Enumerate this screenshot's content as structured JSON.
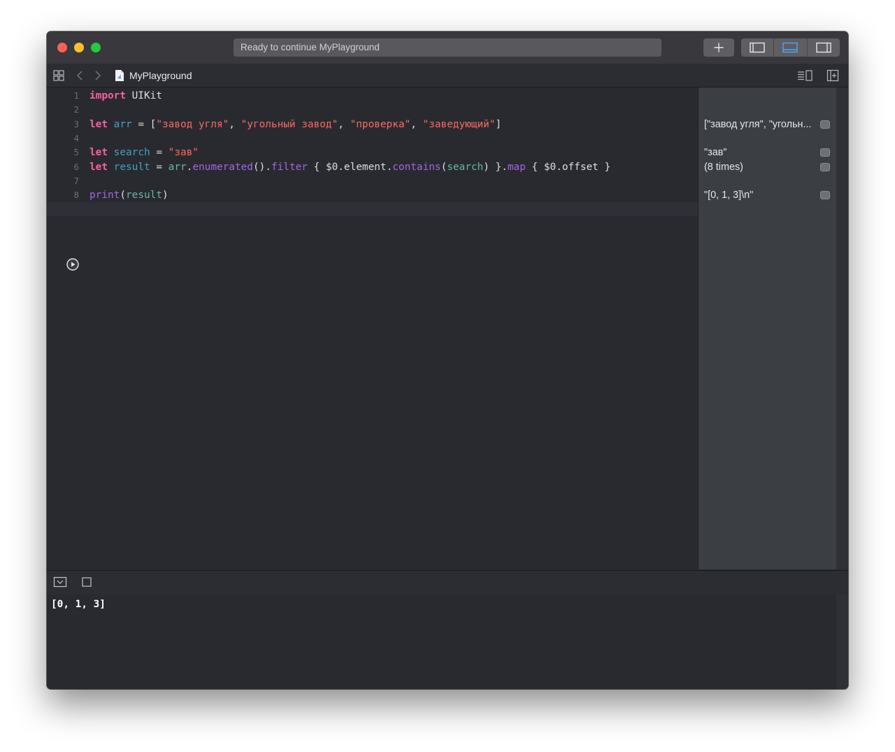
{
  "window": {
    "status": "Ready to continue MyPlayground"
  },
  "toolbar": {
    "add_icon": "plus-icon",
    "view_buttons": [
      "hide-navigator-icon",
      "hide-debug-area-icon",
      "hide-inspector-icon"
    ]
  },
  "navbar": {
    "breadcrumb": "MyPlayground",
    "file_icon": "swift-file-icon"
  },
  "editor": {
    "line_numbers": [
      "1",
      "2",
      "3",
      "4",
      "5",
      "6",
      "7",
      "8"
    ],
    "lines": [
      [
        {
          "t": "import",
          "c": "kw"
        },
        {
          "t": " UIKit",
          "c": "plain"
        }
      ],
      [],
      [
        {
          "t": "let",
          "c": "kw"
        },
        {
          "t": " ",
          "c": "plain"
        },
        {
          "t": "arr",
          "c": "decl"
        },
        {
          "t": " = [",
          "c": "plain"
        },
        {
          "t": "\"завод угля\"",
          "c": "str"
        },
        {
          "t": ", ",
          "c": "plain"
        },
        {
          "t": "\"угольный завод\"",
          "c": "str"
        },
        {
          "t": ", ",
          "c": "plain"
        },
        {
          "t": "\"проверка\"",
          "c": "str"
        },
        {
          "t": ", ",
          "c": "plain"
        },
        {
          "t": "\"заведующий\"",
          "c": "str"
        },
        {
          "t": "]",
          "c": "plain"
        }
      ],
      [],
      [
        {
          "t": "let",
          "c": "kw"
        },
        {
          "t": " ",
          "c": "plain"
        },
        {
          "t": "search",
          "c": "decl"
        },
        {
          "t": " = ",
          "c": "plain"
        },
        {
          "t": "\"зав\"",
          "c": "str"
        }
      ],
      [
        {
          "t": "let",
          "c": "kw"
        },
        {
          "t": " ",
          "c": "plain"
        },
        {
          "t": "result",
          "c": "decl"
        },
        {
          "t": " = ",
          "c": "plain"
        },
        {
          "t": "arr",
          "c": "proj"
        },
        {
          "t": ".",
          "c": "plain"
        },
        {
          "t": "enumerated",
          "c": "fn"
        },
        {
          "t": "().",
          "c": "plain"
        },
        {
          "t": "filter",
          "c": "fn"
        },
        {
          "t": " { $0.element.",
          "c": "plain"
        },
        {
          "t": "contains",
          "c": "fn"
        },
        {
          "t": "(",
          "c": "plain"
        },
        {
          "t": "search",
          "c": "proj"
        },
        {
          "t": ") }.",
          "c": "plain"
        },
        {
          "t": "map",
          "c": "fn"
        },
        {
          "t": " { $0.offset }",
          "c": "plain"
        }
      ],
      [],
      [
        {
          "t": "print",
          "c": "fn"
        },
        {
          "t": "(",
          "c": "plain"
        },
        {
          "t": "result",
          "c": "proj"
        },
        {
          "t": ")",
          "c": "plain"
        }
      ]
    ]
  },
  "results": [
    {
      "line": 3,
      "text": "[\"завод угля\", \"угольн..."
    },
    {
      "line": 5,
      "text": "\"зав\""
    },
    {
      "line": 6,
      "text": "(8 times)"
    },
    {
      "line": 8,
      "text": "\"[0, 1, 3]\\n\""
    }
  ],
  "console": {
    "output": "[0, 1, 3]"
  },
  "colors": {
    "keyword": "#fc5fa3",
    "string": "#fc6a5d",
    "declaration": "#41a1c0",
    "function": "#a167e6",
    "project_identifier": "#67b7a4"
  }
}
